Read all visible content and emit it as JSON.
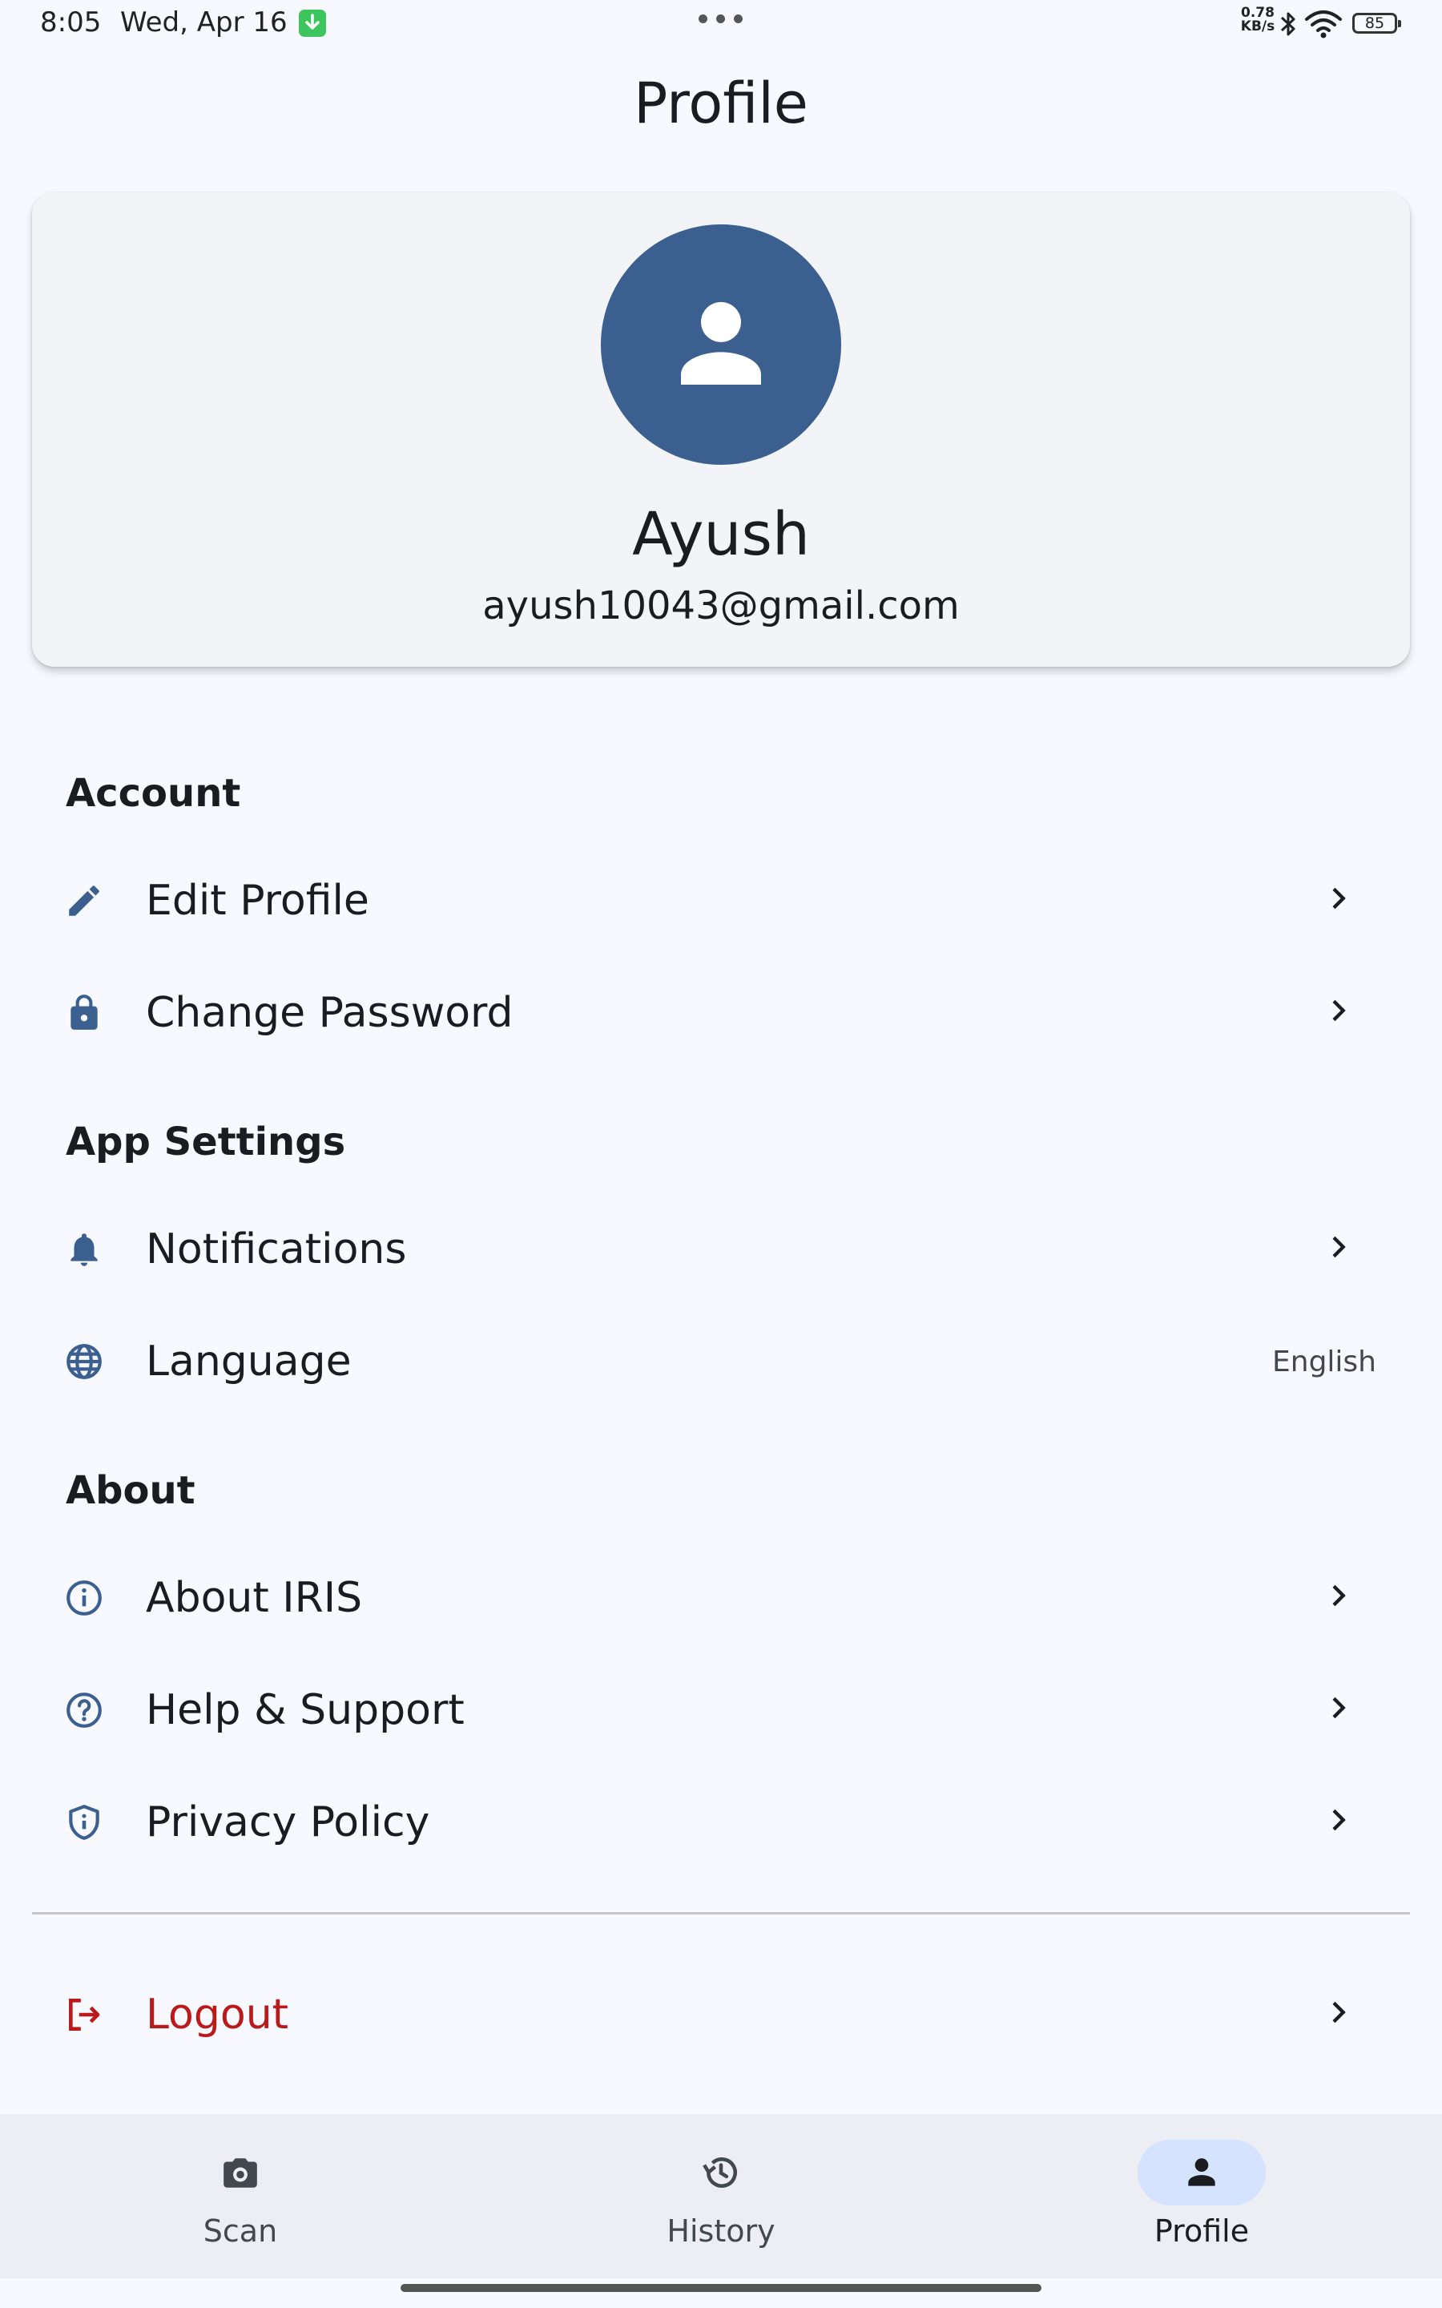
{
  "status_bar": {
    "time": "8:05",
    "date": "Wed, Apr 16",
    "net_speed_value": "0.78",
    "net_speed_unit": "KB/s",
    "battery": "85",
    "icons": [
      "download-icon",
      "bluetooth-icon",
      "wifi-icon",
      "battery-icon"
    ]
  },
  "page": {
    "title": "Profile"
  },
  "profile": {
    "name": "Ayush",
    "email": "ayush10043@gmail.com",
    "avatar_icon": "person-icon",
    "avatar_color": "#3b5f8f"
  },
  "sections": {
    "account": {
      "title": "Account",
      "items": [
        {
          "label": "Edit Profile",
          "icon": "pencil-icon"
        },
        {
          "label": "Change Password",
          "icon": "lock-icon"
        }
      ]
    },
    "app_settings": {
      "title": "App Settings",
      "items": [
        {
          "label": "Notifications",
          "icon": "bell-icon"
        },
        {
          "label": "Language",
          "icon": "globe-icon",
          "value": "English"
        }
      ]
    },
    "about": {
      "title": "About",
      "items": [
        {
          "label": "About IRIS",
          "icon": "info-icon"
        },
        {
          "label": "Help & Support",
          "icon": "help-icon"
        },
        {
          "label": "Privacy Policy",
          "icon": "shield-icon"
        }
      ]
    }
  },
  "logout": {
    "label": "Logout",
    "icon": "logout-icon",
    "color": "#ba1a1a"
  },
  "bottom_nav": {
    "items": [
      {
        "label": "Scan",
        "icon": "camera-icon",
        "active": false
      },
      {
        "label": "History",
        "icon": "history-icon",
        "active": false
      },
      {
        "label": "Profile",
        "icon": "person-icon",
        "active": true
      }
    ]
  },
  "colors": {
    "accent": "#3b5f8f",
    "background": "#f8f9ff",
    "nav_active_pill": "#d6e3ff",
    "logout": "#ba1a1a"
  }
}
